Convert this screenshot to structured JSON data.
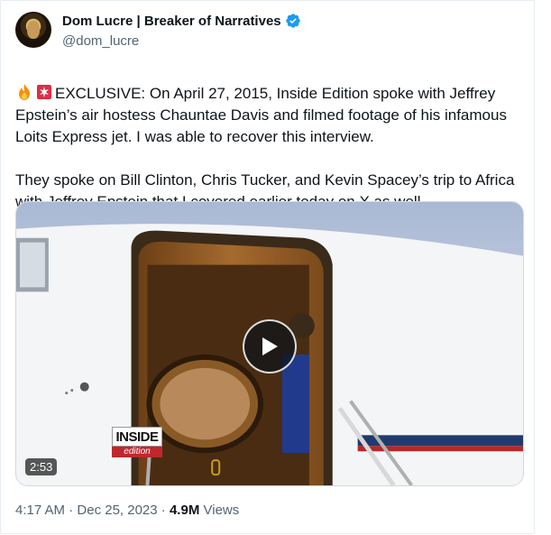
{
  "author": {
    "display_name": "Dom Lucre | Breaker of Narratives",
    "handle": "@dom_lucre",
    "verified": true,
    "verified_color": "#1d9bf0"
  },
  "tweet": {
    "paragraph1": "EXCLUSIVE: On April 27, 2015, Inside Edition spoke with Jeffrey Epstein’s air hostess Chauntae Davis and filmed footage of his infamous Loits Express jet. I was able to recover this interview.",
    "paragraph2": "They spoke on Bill Clinton, Chris Tucker, and Kevin Spacey’s trip to Africa with Jeffrey Epstein that I covered earlier today on X as well.",
    "emojis": [
      "fire-emoji",
      "siren-emoji"
    ]
  },
  "media": {
    "duration": "2:53",
    "watermark_top": "INSIDE",
    "watermark_bottom": "edition"
  },
  "meta": {
    "time": "4:17 AM",
    "separator": "·",
    "date": "Dec 25, 2023",
    "views_count": "4.9M",
    "views_label": "Views"
  }
}
